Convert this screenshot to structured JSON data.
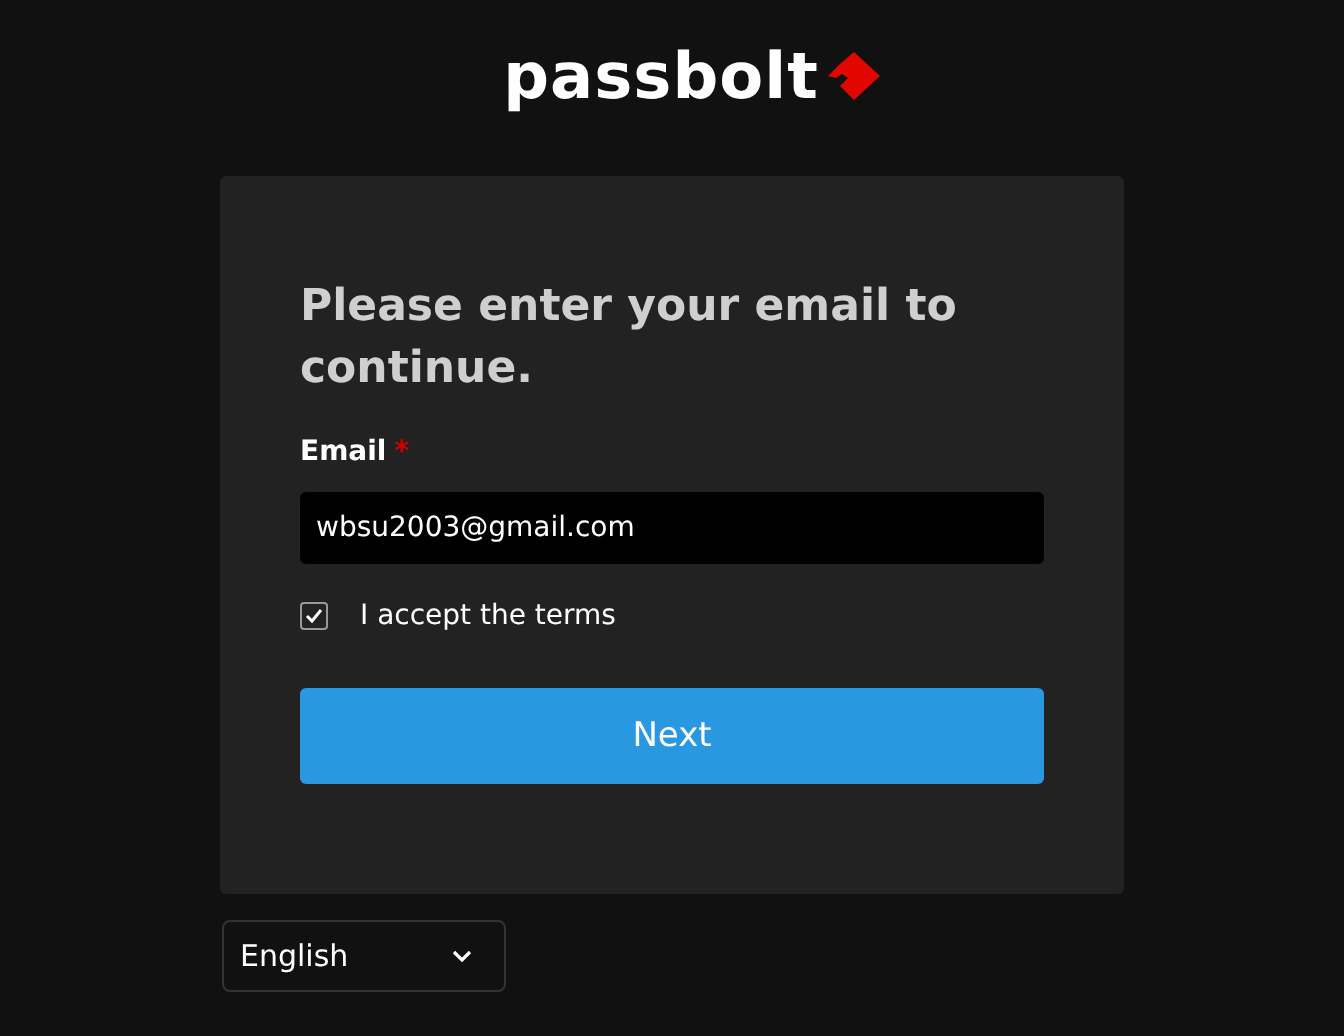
{
  "logo": {
    "text": "passbolt"
  },
  "form": {
    "heading": "Please enter your email to continue.",
    "email_label": "Email",
    "required_mark": "*",
    "email_value": "wbsu2003@gmail.com",
    "terms": {
      "label": "I accept the terms",
      "checked": true
    },
    "next_button": "Next"
  },
  "language_select": {
    "value": "English"
  }
}
